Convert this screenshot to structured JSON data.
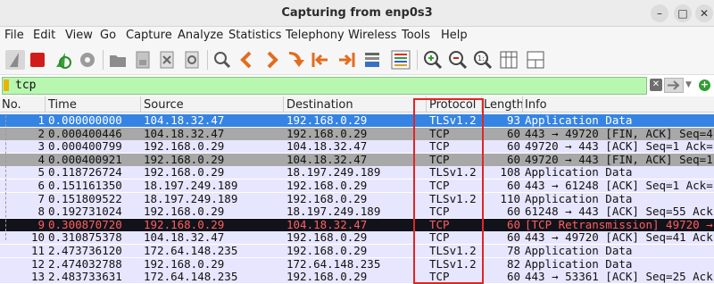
{
  "window": {
    "title": "Capturing from enp0s3",
    "minimize": "–",
    "maximize": "□",
    "close": "✕"
  },
  "menu": [
    "File",
    "Edit",
    "View",
    "Go",
    "Capture",
    "Analyze",
    "Statistics",
    "Telephony",
    "Wireless",
    "Tools",
    "Help"
  ],
  "toolbar_icons": [
    "shark-fin-icon",
    "stop-icon",
    "restart-icon",
    "options-gear-icon",
    "open-folder-icon",
    "save-file-icon",
    "close-file-icon",
    "reload-icon",
    "find-icon",
    "go-back-icon",
    "go-forward-icon",
    "go-to-packet-icon",
    "first-packet-icon",
    "last-packet-icon",
    "auto-scroll-icon",
    "colorize-icon",
    "zoom-in-icon",
    "zoom-out-icon",
    "zoom-normal-icon",
    "resize-columns-icon",
    "layout-icon"
  ],
  "filter": {
    "value": "tcp"
  },
  "columns": {
    "no": "No.",
    "time": "Time",
    "source": "Source",
    "destination": "Destination",
    "protocol": "Protocol",
    "length": "Length",
    "info": "Info"
  },
  "packets": [
    {
      "no": "1",
      "time": "0.000000000",
      "src": "104.18.32.47",
      "dst": "192.168.0.29",
      "proto": "TLSv1.2",
      "len": "93",
      "info": "Application Data",
      "style": "selected"
    },
    {
      "no": "2",
      "time": "0.000400446",
      "src": "104.18.32.47",
      "dst": "192.168.0.29",
      "proto": "TCP",
      "len": "60",
      "info": "443 → 49720 [FIN, ACK] Seq=4",
      "style": "gray"
    },
    {
      "no": "3",
      "time": "0.000400799",
      "src": "192.168.0.29",
      "dst": "104.18.32.47",
      "proto": "TCP",
      "len": "60",
      "info": "49720 → 443 [ACK] Seq=1 Ack=",
      "style": "light"
    },
    {
      "no": "4",
      "time": "0.000400921",
      "src": "192.168.0.29",
      "dst": "104.18.32.47",
      "proto": "TCP",
      "len": "60",
      "info": "49720 → 443 [FIN, ACK] Seq=1",
      "style": "gray"
    },
    {
      "no": "5",
      "time": "0.118726724",
      "src": "192.168.0.29",
      "dst": "18.197.249.189",
      "proto": "TLSv1.2",
      "len": "108",
      "info": "Application Data",
      "style": "light"
    },
    {
      "no": "6",
      "time": "0.151161350",
      "src": "18.197.249.189",
      "dst": "192.168.0.29",
      "proto": "TCP",
      "len": "60",
      "info": "443 → 61248 [ACK] Seq=1 Ack=",
      "style": "light"
    },
    {
      "no": "7",
      "time": "0.151809522",
      "src": "18.197.249.189",
      "dst": "192.168.0.29",
      "proto": "TLSv1.2",
      "len": "110",
      "info": "Application Data",
      "style": "light"
    },
    {
      "no": "8",
      "time": "0.192731024",
      "src": "192.168.0.29",
      "dst": "18.197.249.189",
      "proto": "TCP",
      "len": "60",
      "info": "61248 → 443 [ACK] Seq=55 Ack",
      "style": "light"
    },
    {
      "no": "9",
      "time": "0.300870720",
      "src": "192.168.0.29",
      "dst": "104.18.32.47",
      "proto": "TCP",
      "len": "60",
      "info": "[TCP Retransmission] 49720 →",
      "style": "dark"
    },
    {
      "no": "10",
      "time": "0.310875378",
      "src": "104.18.32.47",
      "dst": "192.168.0.29",
      "proto": "TCP",
      "len": "60",
      "info": "443 → 49720 [ACK] Seq=41 Ack",
      "style": "light"
    },
    {
      "no": "11",
      "time": "2.473736120",
      "src": "172.64.148.235",
      "dst": "192.168.0.29",
      "proto": "TLSv1.2",
      "len": "78",
      "info": "Application Data",
      "style": "light"
    },
    {
      "no": "12",
      "time": "2.474032788",
      "src": "192.168.0.29",
      "dst": "172.64.148.235",
      "proto": "TLSv1.2",
      "len": "82",
      "info": "Application Data",
      "style": "light"
    },
    {
      "no": "13",
      "time": "2.483733631",
      "src": "172.64.148.235",
      "dst": "192.168.0.29",
      "proto": "TCP",
      "len": "60",
      "info": "443 → 53361 [ACK] Seq=25 Ack",
      "style": "light"
    }
  ],
  "colors": {
    "selected_bg": "#3584e4",
    "selected_fg": "#ffffff",
    "gray_bg": "#a8a8a8",
    "light_bg": "#e7e6ff",
    "dark_bg": "#12121a",
    "dark_fg": "#ff5f5f",
    "filter_bg": "#b8f7b0",
    "highlight_box": "#e02525"
  }
}
